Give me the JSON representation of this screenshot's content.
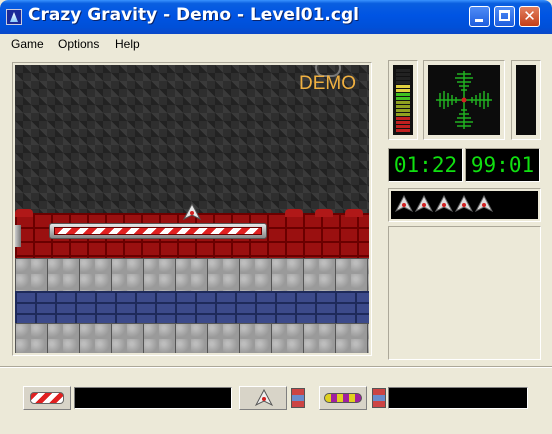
{
  "window": {
    "title": "Crazy Gravity - Demo - Level01.cgl",
    "app_icon": "rocket-icon",
    "controls": {
      "minimize": "minimize-icon",
      "maximize": "maximize-icon",
      "close": "close-icon",
      "close_glyph": "✕"
    }
  },
  "menu": {
    "items": [
      "Game",
      "Options",
      "Help"
    ]
  },
  "game": {
    "overlay_label": "DEMO",
    "colors": {
      "overlay": "#f0b040",
      "wall": "#9a1010",
      "stone": "#9a9a9a",
      "water_brick": "#3c4a8a"
    }
  },
  "hud": {
    "fuel_level": 0.76,
    "timer": "01:22",
    "fuel_readout": "99:01",
    "lives": 5,
    "life_icon": "ship-icon",
    "readout_color": "#10e010"
  },
  "toolbar": {
    "items": [
      {
        "icon": "landing-pad-icon"
      },
      {
        "icon": "ship-icon"
      },
      {
        "icon": "indicator-icon"
      },
      {
        "icon": "capsule-icon"
      },
      {
        "icon": "indicator-icon"
      }
    ]
  }
}
